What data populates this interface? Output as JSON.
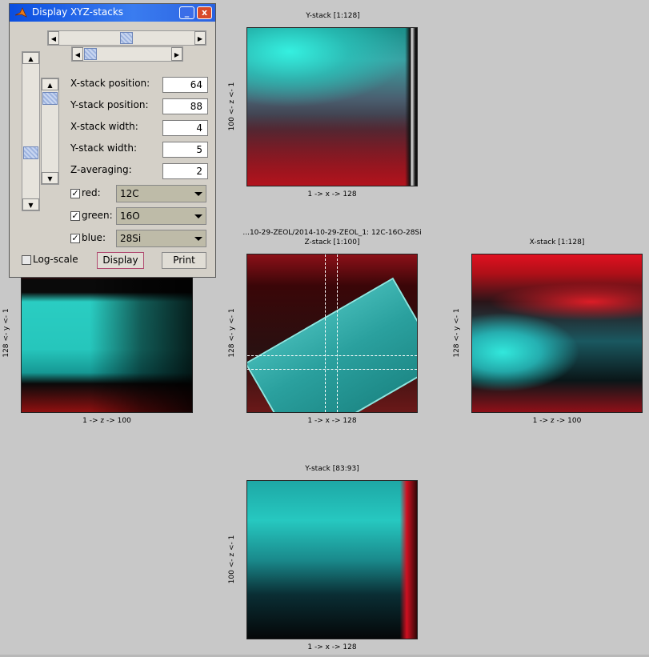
{
  "window": {
    "title": "Display XYZ-stacks",
    "minimize_glyph": "_",
    "close_glyph": "x"
  },
  "controls": {
    "fields": [
      {
        "label": "X-stack position:",
        "value": "64"
      },
      {
        "label": "Y-stack position:",
        "value": "88"
      },
      {
        "label": "X-stack width:",
        "value": "4"
      },
      {
        "label": "Y-stack width:",
        "value": "5"
      },
      {
        "label": "Z-averaging:",
        "value": "2"
      }
    ],
    "channels": [
      {
        "label": "red:",
        "checked": true,
        "selected": "12C"
      },
      {
        "label": "green:",
        "checked": true,
        "selected": "16O"
      },
      {
        "label": "blue:",
        "checked": true,
        "selected": "28Si"
      }
    ],
    "log_scale": {
      "label": "Log-scale",
      "checked": false
    },
    "display_button": "Display",
    "print_button": "Print",
    "sliders": {
      "top_horizontal_fraction": 0.48,
      "second_horizontal_fraction": 0.1,
      "left_vertical_fraction": 0.67,
      "right_vertical_fraction": 0.15
    }
  },
  "plots": {
    "y_stack_top": {
      "title": "Y-stack [1:128]",
      "xlabel": "1 -> x -> 128",
      "ylabel": "100 <- z <- 1"
    },
    "z_stack": {
      "title_line1": "...10-29-ZEOL/2014-10-29-ZEOL_1: 12C-16O-28Si",
      "title_line2": "Z-stack [1:100]",
      "xlabel": "1 -> x -> 128",
      "ylabel": "128 <- y <- 1"
    },
    "x_stack": {
      "title": "X-stack [1:128]",
      "xlabel": "1 -> z -> 100",
      "ylabel": "128 <- y <- 1"
    },
    "left_stack": {
      "xlabel": "1 -> z -> 100",
      "ylabel": "128 <- y <- 1"
    },
    "y_stack_bottom": {
      "title": "Y-stack [83:93]",
      "xlabel": "1 -> x -> 128",
      "ylabel": "100 <- z <- 1"
    }
  }
}
